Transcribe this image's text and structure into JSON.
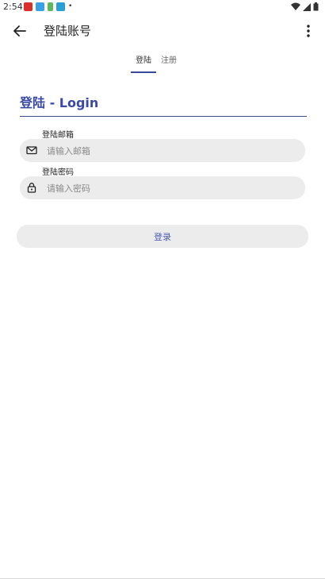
{
  "status_bar": {
    "time": "2:54"
  },
  "app_bar": {
    "title": "登陆账号"
  },
  "tabs": [
    {
      "label": "登陆",
      "active": true
    },
    {
      "label": "注册",
      "active": false
    }
  ],
  "form": {
    "heading": "登陆 - Login",
    "email": {
      "label": "登陆邮箱",
      "placeholder": "请输入邮箱",
      "value": ""
    },
    "password": {
      "label": "登陆密码",
      "placeholder": "请输入密码",
      "value": ""
    },
    "submit_label": "登录"
  },
  "colors": {
    "accent": "#3a4aa6",
    "field_bg": "#ececec"
  }
}
